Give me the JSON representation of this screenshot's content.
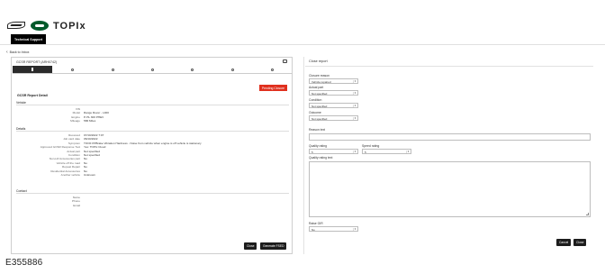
{
  "app": {
    "brand_name": "TOPIx"
  },
  "nav": {
    "technical_support": "Technical Support"
  },
  "back_link": "Back to Inbox",
  "report": {
    "title": "GCSR REPORT (ARH0742)",
    "status_button": "Pending Closure",
    "section_heading": "GCSR Report Detail",
    "vehicle_subheader": "Vehicle",
    "vehicle_rows": [
      {
        "label": "VIN",
        "value": ""
      },
      {
        "label": "Model",
        "value": "Range Rover - L460"
      },
      {
        "label": "Engine",
        "value": "P-HL 300 PHEV"
      },
      {
        "label": "Mileage",
        "value": "586 Miles"
      }
    ],
    "details_subheader": "Details",
    "details_rows": [
      {
        "label": "Received",
        "value": "07/10/2022 7:07"
      },
      {
        "label": "Job card date",
        "value": "06/10/2022"
      },
      {
        "label": "Symptom",
        "value": "TOOF PPBrake Vibration Hardness - Noise from vehicle when engine is off vehicle is stationary"
      },
      {
        "label": "Approved GCSR Response Tool",
        "value": "Yes: TOPIx Cloud"
      },
      {
        "label": "Actual part",
        "value": "Not specified"
      },
      {
        "label": "Condition",
        "value": "Not specified"
      },
      {
        "label": "Non-LR Accessories part",
        "value": "No"
      },
      {
        "label": "Vehicle off the road",
        "value": "No"
      },
      {
        "label": "Repeat Repair",
        "value": "No"
      },
      {
        "label": "Residential Accessories",
        "value": "No"
      },
      {
        "label": "Another vehicle",
        "value": "Unknown"
      }
    ],
    "contact_subheader": "Contact",
    "contact_rows": [
      {
        "label": "Name",
        "value": ""
      },
      {
        "label": "Phone",
        "value": ""
      },
      {
        "label": "Email",
        "value": ""
      }
    ],
    "close_button": "Close",
    "generate_button": "Generate FSED"
  },
  "close_report": {
    "title": "Close report",
    "closure_reason": {
      "label": "Closure reason",
      "value": "Vehicle repaired"
    },
    "actual_part": {
      "label": "Actual part",
      "value": "Not specified"
    },
    "condition": {
      "label": "Condition",
      "value": "Not specified"
    },
    "outcome": {
      "label": "Outcome",
      "value": "Not specified"
    },
    "reason_text": {
      "label": "Reason text",
      "value": ""
    },
    "quality_rating": {
      "label": "Quality rating",
      "value": "5"
    },
    "speed_rating": {
      "label": "Speed rating",
      "value": "5"
    },
    "quality_rating_text": {
      "label": "Quality rating text",
      "value": ""
    },
    "raise_gir": {
      "label": "Raise GIR",
      "value": "No"
    },
    "cancel_button": "Cancel",
    "close_button": "Close"
  },
  "caption": "E355886",
  "colors": {
    "accent_red": "#e0301e",
    "dark": "#1d1d1d",
    "land_rover_green": "#005a2b"
  }
}
